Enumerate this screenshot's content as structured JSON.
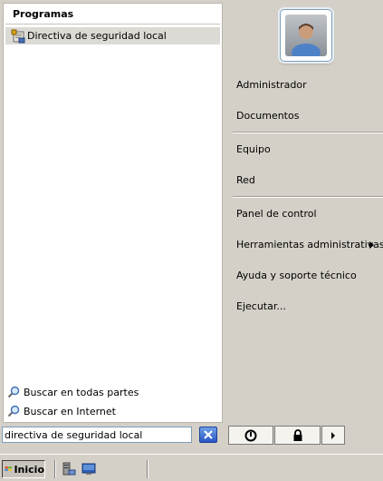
{
  "programs": {
    "header": "Programas",
    "items": [
      {
        "label": "Directiva de seguridad local",
        "icon": "security-policy-icon"
      }
    ]
  },
  "search_links": [
    {
      "label": "Buscar en todas partes",
      "icon": "magnifier-icon"
    },
    {
      "label": "Buscar en Internet",
      "icon": "magnifier-icon"
    }
  ],
  "right_items": {
    "administrador": "Administrador",
    "documentos": "Documentos",
    "equipo": "Equipo",
    "red": "Red",
    "panel_control": "Panel de control",
    "herramientas": "Herramientas administrativas",
    "ayuda": "Ayuda y soporte técnico",
    "ejecutar": "Ejecutar..."
  },
  "search": {
    "value": "directiva de seguridad local"
  },
  "taskbar": {
    "start_label": "Inicio"
  },
  "colors": {
    "face": "#d4d0c8",
    "selection": "#dcdad5",
    "clear_button": "#2856c5"
  }
}
